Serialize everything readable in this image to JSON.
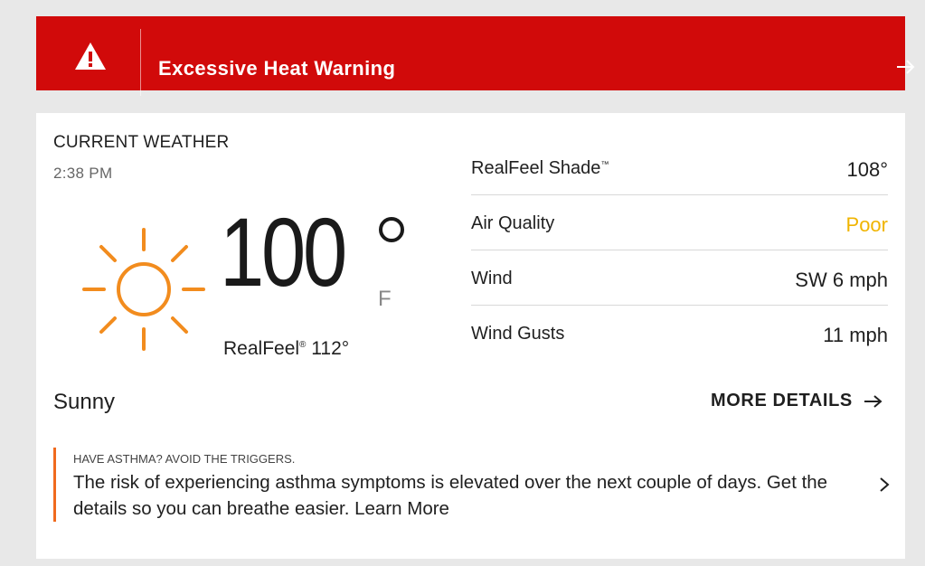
{
  "alert": {
    "title": "Excessive Heat Warning",
    "icon": "warning-icon",
    "arrow_icon": "arrow-right-icon",
    "color": "#d10a0a"
  },
  "current": {
    "section_title": "CURRENT WEATHER",
    "time": "2:38 PM",
    "condition_icon": "sun-icon",
    "temperature": "100",
    "unit": "F",
    "realfeel_label": "RealFeel",
    "realfeel_mark": "®",
    "realfeel_value": "112°",
    "condition": "Sunny",
    "sun_color": "#f28c1e"
  },
  "details": {
    "rows": [
      {
        "label": "RealFeel Shade",
        "mark": "™",
        "value": "108°"
      },
      {
        "label": "Air Quality",
        "mark": "",
        "value": "Poor",
        "value_color": "#f0b400"
      },
      {
        "label": "Wind",
        "mark": "",
        "value": "SW 6 mph"
      },
      {
        "label": "Wind Gusts",
        "mark": "",
        "value": "11 mph"
      }
    ],
    "more_label": "MORE DETAILS"
  },
  "promo": {
    "kicker": "HAVE ASTHMA? AVOID THE TRIGGERS.",
    "text": "The risk of experiencing asthma symptoms is elevated over the next couple of days. Get the details so you can breathe easier. Learn More",
    "accent_color": "#f06a1e"
  }
}
